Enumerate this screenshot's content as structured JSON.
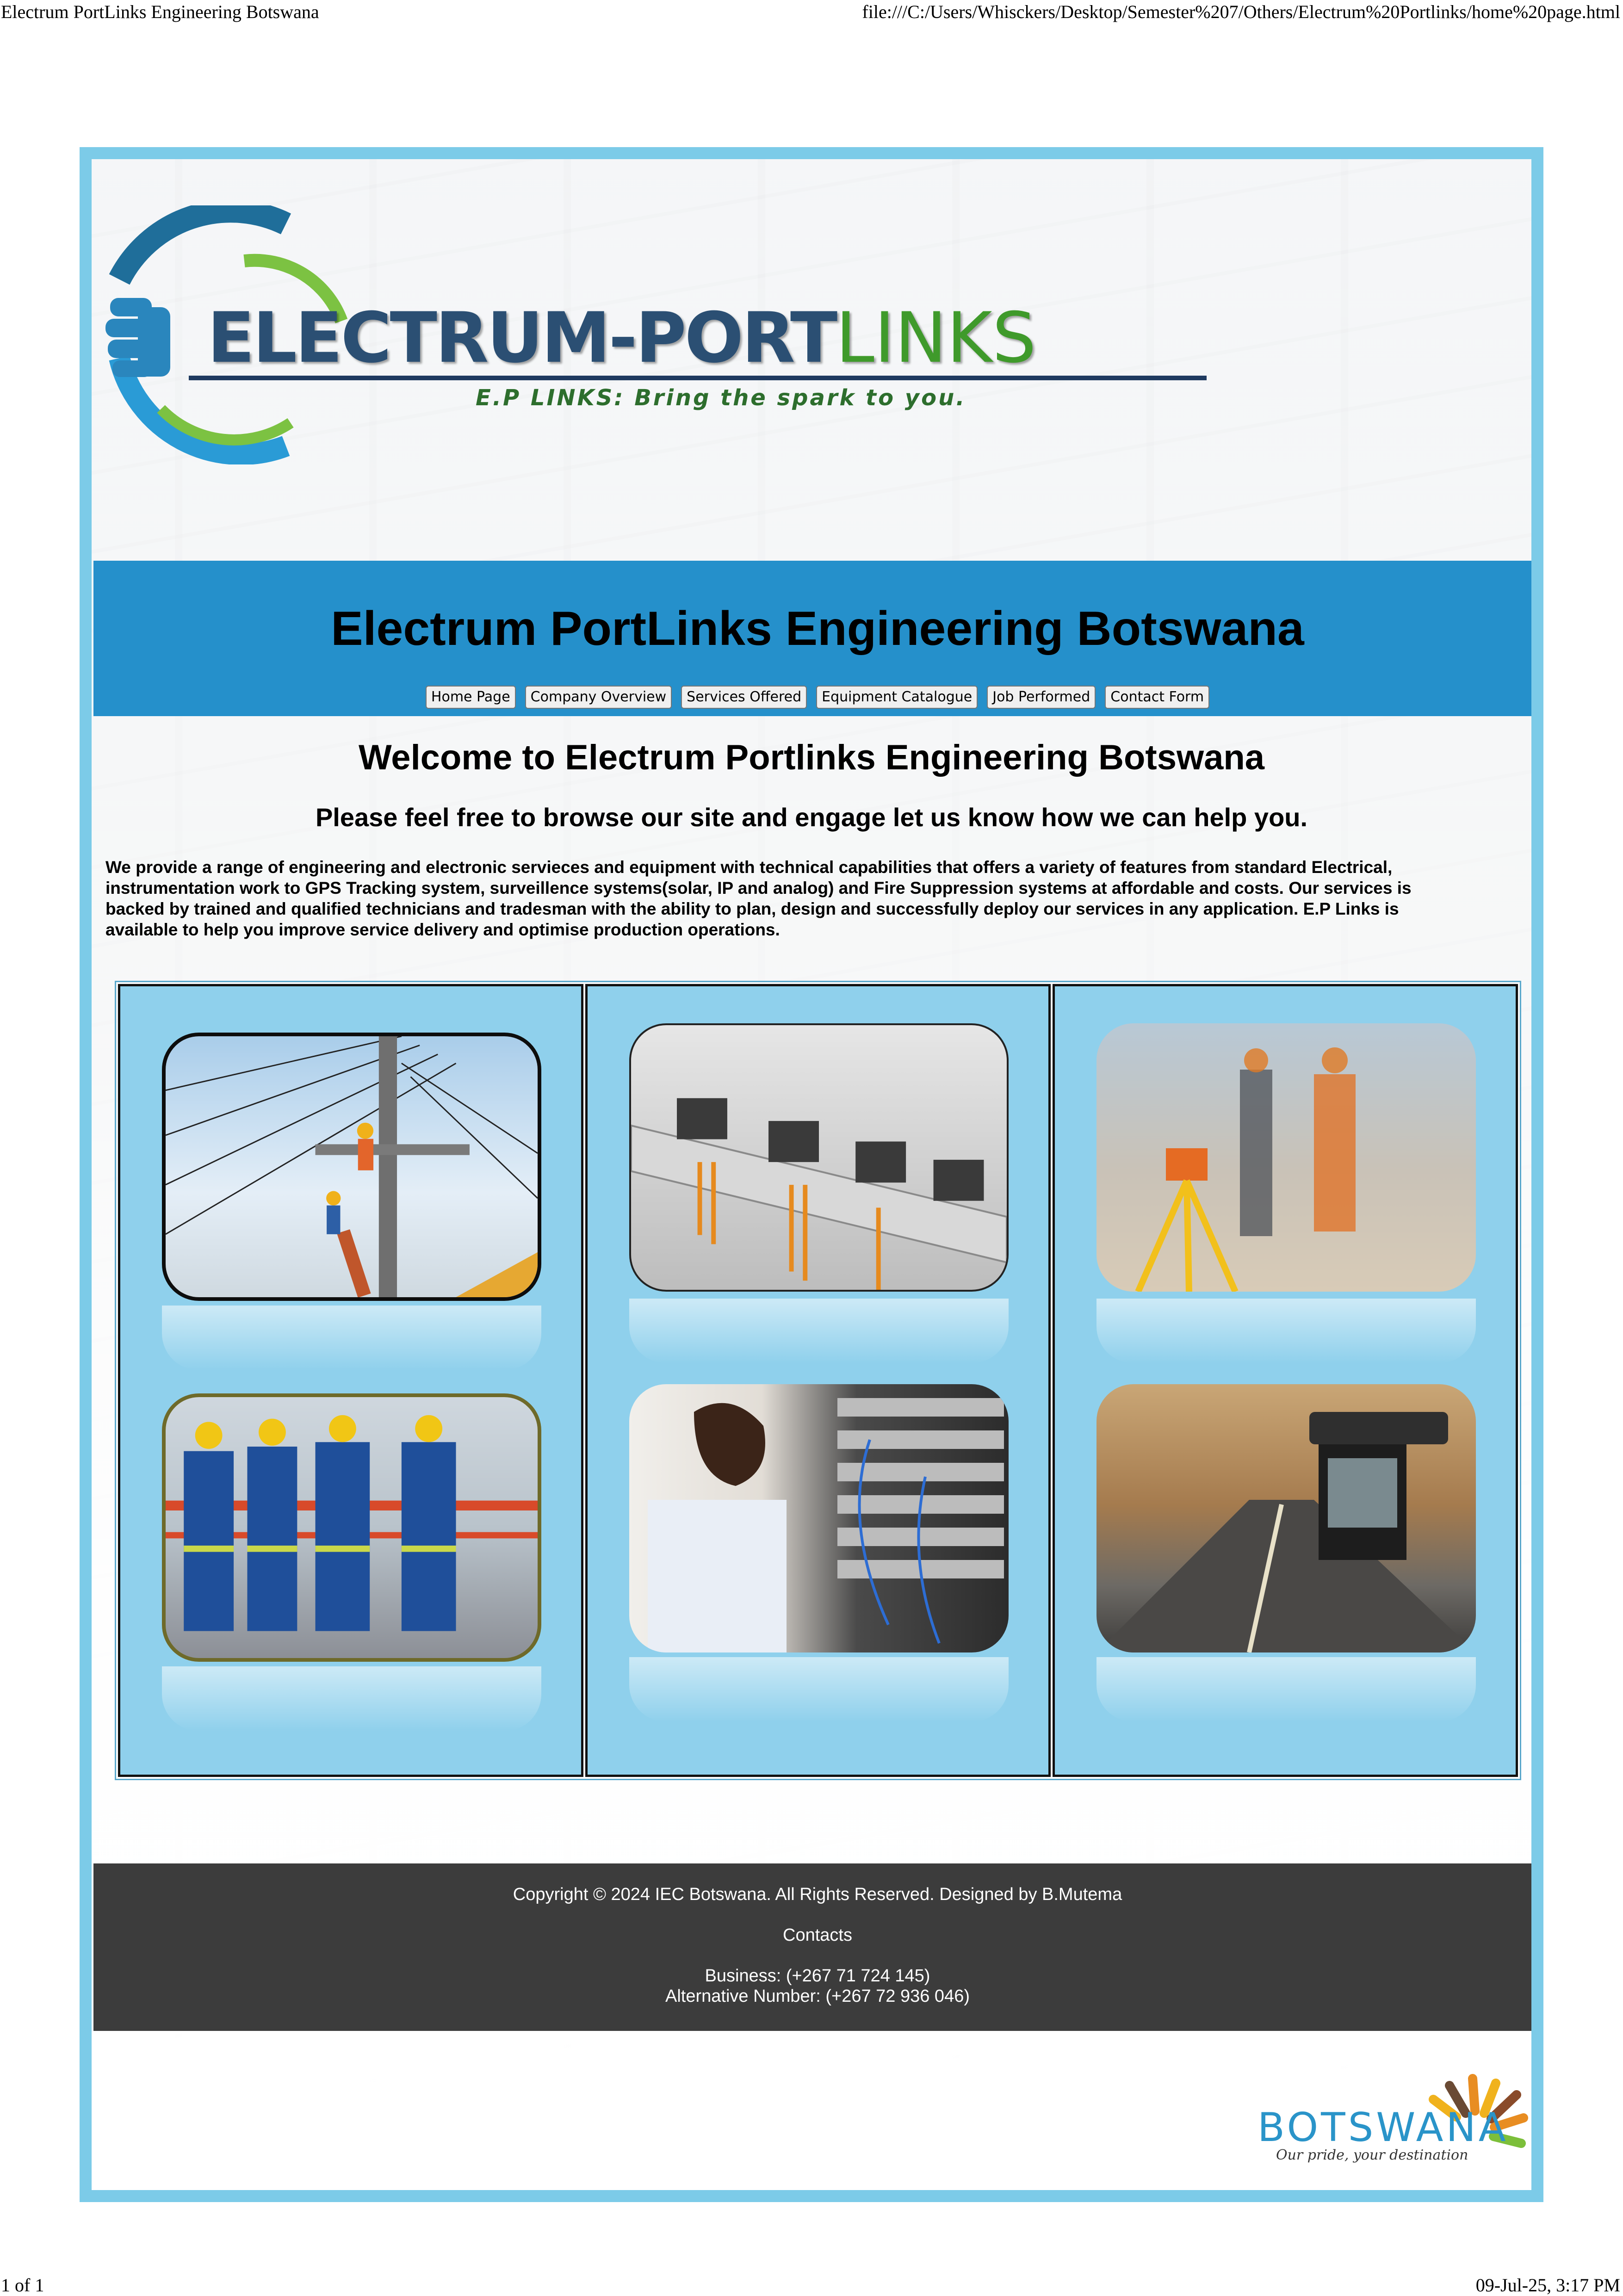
{
  "browser": {
    "page_title": "Electrum PortLinks Engineering Botswana",
    "url": "file:///C:/Users/Whisckers/Desktop/Semester%207/Others/Electrum%20Portlinks/home%20page.html",
    "page_count": "1 of 1",
    "timestamp": "09-Jul-25, 3:17 PM"
  },
  "logo": {
    "brand_main": "ELECTRUM-PORT",
    "brand_accent": "LINKS",
    "tagline": "E.P LINKS: Bring the spark to you.",
    "colors": {
      "blue": "#2b4f73",
      "green": "#3f9a2b"
    }
  },
  "header": {
    "title": "Electrum PortLinks Engineering Botswana",
    "background": "#2590cb"
  },
  "nav": {
    "items": [
      {
        "label": "Home Page"
      },
      {
        "label": "Company Overview"
      },
      {
        "label": "Services Offered"
      },
      {
        "label": "Equipment Catalogue"
      },
      {
        "label": "Job Performed"
      },
      {
        "label": "Contact Form"
      }
    ]
  },
  "main": {
    "welcome": "Welcome to Electrum Portlinks Engineering Botswana",
    "subheading": "Please feel free to browse our site and engage let us know how we can help you.",
    "intro": "We provide a range of engineering and electronic servieces and equipment with technical capabilities that offers a variety of features from standard Electrical, instrumentation work to GPS Tracking system, surveillence systems(solar, IP and analog) and Fire Suppression systems at affordable and costs. Our services is backed by trained and qualified technicians and tradesman with the ability to plan, design and successfully deploy our services in any application. E.P Links is available to help you improve service delivery and optimise production operations."
  },
  "gallery": {
    "background": "#8fd0ec",
    "images": [
      {
        "subject": "power-line-workers"
      },
      {
        "subject": "din-rail-terminals"
      },
      {
        "subject": "surveyor-tripod"
      },
      {
        "subject": "workers-in-uniform"
      },
      {
        "subject": "server-rack-technician"
      },
      {
        "subject": "dash-camera"
      }
    ]
  },
  "footer": {
    "copyright": "Copyright © 2024 IEC Botswana. All Rights Reserved. Designed by B.Mutema",
    "contacts_heading": "Contacts",
    "business": "Business: (+267 71 724 145)",
    "alternative": "Alternative Number: (+267 72 936 046)",
    "background": "#3c3c3c"
  },
  "tourism_logo": {
    "word": "BOTSWANA",
    "slogan": "Our pride, your destination"
  }
}
